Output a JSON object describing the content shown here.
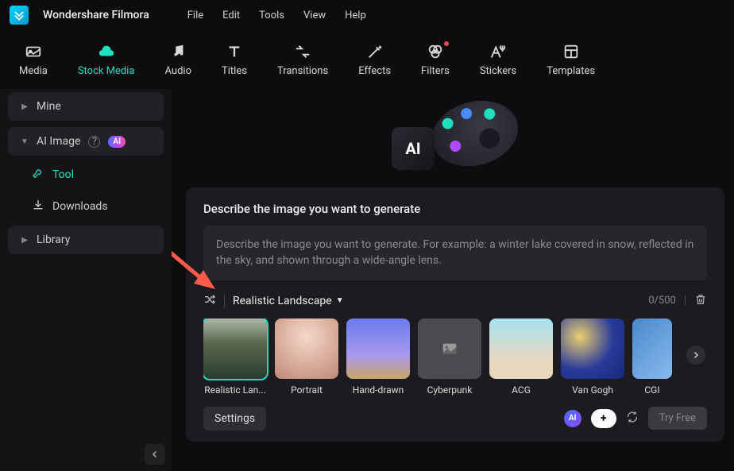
{
  "app": {
    "title": "Wondershare Filmora"
  },
  "menubar": [
    "File",
    "Edit",
    "Tools",
    "View",
    "Help"
  ],
  "toolbar": [
    {
      "id": "media",
      "label": "Media"
    },
    {
      "id": "stock-media",
      "label": "Stock Media",
      "active": true
    },
    {
      "id": "audio",
      "label": "Audio"
    },
    {
      "id": "titles",
      "label": "Titles"
    },
    {
      "id": "transitions",
      "label": "Transitions"
    },
    {
      "id": "effects",
      "label": "Effects"
    },
    {
      "id": "filters",
      "label": "Filters",
      "dot": true
    },
    {
      "id": "stickers",
      "label": "Stickers"
    },
    {
      "id": "templates",
      "label": "Templates"
    }
  ],
  "sidebar": {
    "mine": "Mine",
    "ai_image": "AI Image",
    "ai_badge": "AI",
    "tool": "Tool",
    "downloads": "Downloads",
    "library": "Library"
  },
  "hero": {
    "ai_tile": "AI"
  },
  "panel": {
    "title": "Describe the image you want to generate",
    "placeholder": "Describe the image you want to generate. For example: a winter lake covered in snow, reflected in the sky, and shown through a wide-angle lens.",
    "selected_style": "Realistic Landscape",
    "counter": "0/500",
    "styles": [
      {
        "id": "realistic-landscape",
        "label": "Realistic Lan...",
        "selected": true
      },
      {
        "id": "portrait",
        "label": "Portrait"
      },
      {
        "id": "hand-drawn",
        "label": "Hand-drawn"
      },
      {
        "id": "cyberpunk",
        "label": "Cyberpunk"
      },
      {
        "id": "acg",
        "label": "ACG"
      },
      {
        "id": "van-gogh",
        "label": "Van Gogh"
      },
      {
        "id": "cgi",
        "label": "CGI"
      }
    ],
    "settings": "Settings",
    "ai_badge": "AI",
    "try_free": "Try Free"
  }
}
